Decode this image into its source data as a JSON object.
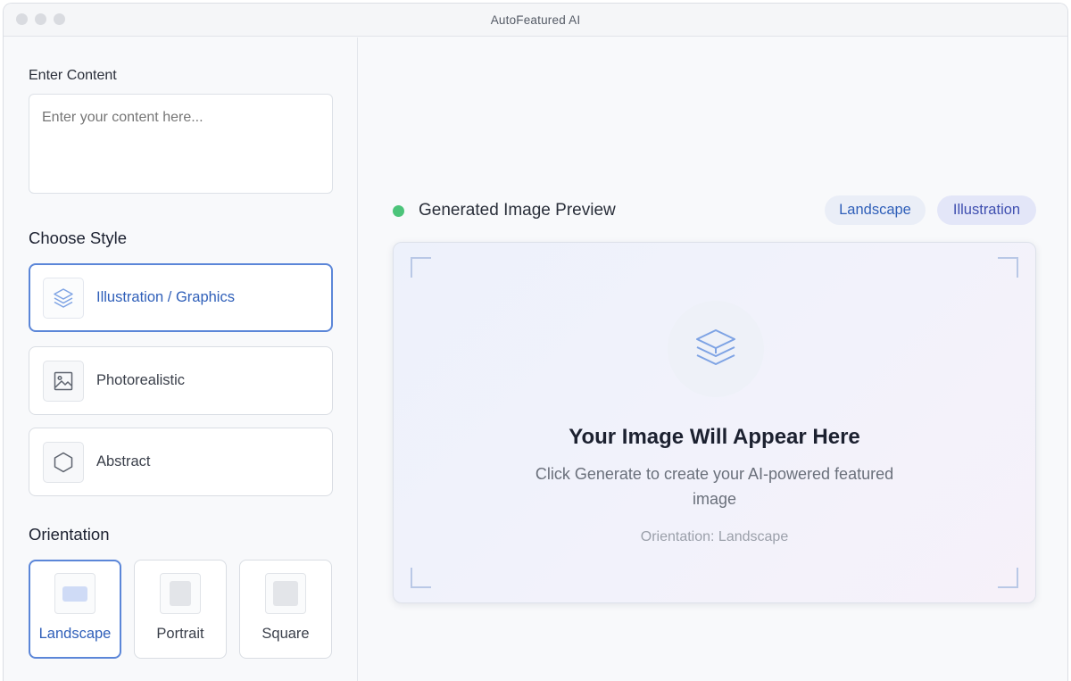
{
  "window": {
    "title": "AutoFeatured AI"
  },
  "sidebar": {
    "content_label": "Enter Content",
    "content_placeholder": "Enter your content here...",
    "style_heading": "Choose Style",
    "styles": [
      {
        "label": "Illustration / Graphics",
        "icon": "layers-icon",
        "selected": true
      },
      {
        "label": "Photorealistic",
        "icon": "image-icon",
        "selected": false
      },
      {
        "label": "Abstract",
        "icon": "hexagon-icon",
        "selected": false
      }
    ],
    "orientation_heading": "Orientation",
    "orientations": [
      {
        "label": "Landscape",
        "selected": true
      },
      {
        "label": "Portrait",
        "selected": false
      },
      {
        "label": "Square",
        "selected": false
      }
    ]
  },
  "preview": {
    "title": "Generated Image Preview",
    "status_color": "#4cc47a",
    "tags": [
      "Landscape",
      "Illustration"
    ],
    "empty_title": "Your Image Will Appear Here",
    "empty_description": "Click Generate to create your AI-powered featured image",
    "orientation_text": "Orientation: Landscape",
    "icon": "layers-icon"
  },
  "colors": {
    "accent": "#5b86d8",
    "accent_text": "#2f5fb9"
  }
}
